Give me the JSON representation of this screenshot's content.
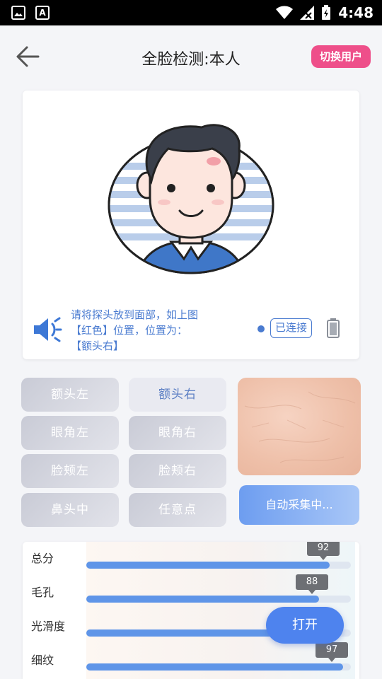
{
  "status_bar": {
    "time": "4:48"
  },
  "header": {
    "title": "全脸检测:本人",
    "switch_user_label": "切换用户"
  },
  "face_card": {
    "instruction_lines": [
      "请将探头放到面部，如上图",
      "【红色】位置，位置为：",
      "【额头右】"
    ],
    "connection_status": "已连接"
  },
  "areas": [
    {
      "label": "额头左",
      "active": false
    },
    {
      "label": "额头右",
      "active": true
    },
    {
      "label": "眼角左",
      "active": false
    },
    {
      "label": "眼角右",
      "active": false
    },
    {
      "label": "脸颊左",
      "active": false
    },
    {
      "label": "脸颊右",
      "active": false
    },
    {
      "label": "鼻头中",
      "active": false
    },
    {
      "label": "任意点",
      "active": false
    }
  ],
  "auto_collect_label": "自动采集中...",
  "scores": [
    {
      "label": "总分",
      "value": 92
    },
    {
      "label": "毛孔",
      "value": 88
    },
    {
      "label": "光滑度",
      "value": ""
    },
    {
      "label": "细纹",
      "value": 97
    }
  ],
  "open_button_label": "打开",
  "colors": {
    "accent_blue": "#4e83ee",
    "switch_user_pink": "#ee4f8a",
    "instruction_blue": "#4a7bd0"
  }
}
